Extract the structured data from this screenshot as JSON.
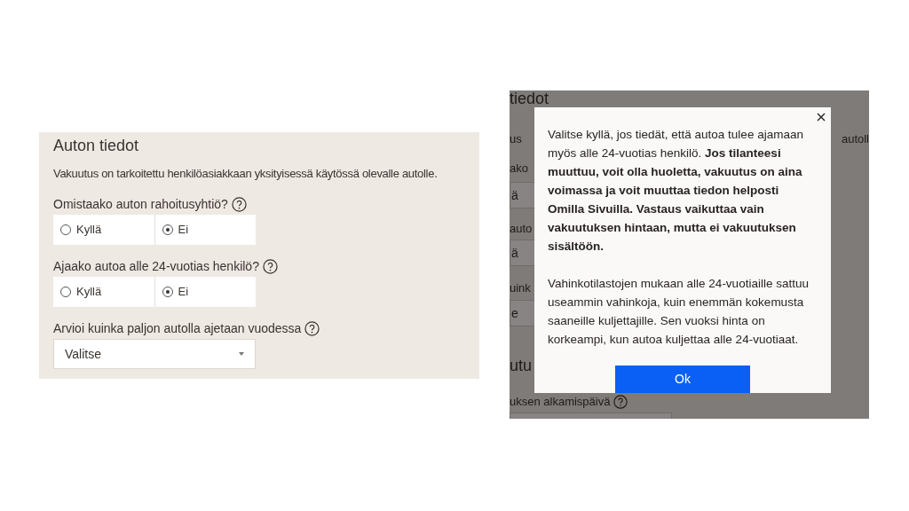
{
  "form": {
    "title": "Auton tiedot",
    "intro": "Vakuutus on tarkoitettu henkilöasiakkaan yksityisessä käytössä olevalle autolle.",
    "questions": [
      {
        "kind": "radio",
        "label": "Omistaako auton rahoitusyhtiö?",
        "options": [
          {
            "label": "Kyllä",
            "selected": false
          },
          {
            "label": "Ei",
            "selected": true
          }
        ]
      },
      {
        "kind": "radio",
        "label": "Ajaako autoa alle 24-vuotias henkilö?",
        "options": [
          {
            "label": "Kyllä",
            "selected": false
          },
          {
            "label": "Ei",
            "selected": true
          }
        ]
      },
      {
        "kind": "select",
        "label": "Arvioi kuinka paljon autolla ajetaan vuodessa",
        "value": "Valitse"
      }
    ]
  },
  "background_page": {
    "rows": [
      {
        "kind": "heading",
        "text": "tiedot"
      },
      {
        "kind": "text",
        "text": "us",
        "right_text": "autoll"
      },
      {
        "kind": "text",
        "text": "ako"
      },
      {
        "kind": "field",
        "text": "ä"
      },
      {
        "kind": "text",
        "text": "auto"
      },
      {
        "kind": "field",
        "text": "ä"
      },
      {
        "kind": "text",
        "text": "uink"
      },
      {
        "kind": "field",
        "text": "e"
      },
      {
        "kind": "heading",
        "text": "utu"
      },
      {
        "kind": "text",
        "text": "uksen alkamispäivä",
        "help": true
      },
      {
        "kind": "date_field"
      }
    ]
  },
  "dialog": {
    "paragraphs": [
      "Valitse kyllä, jos tiedät, että autoa tulee ajamaan myös alle 24-vuotias henkilö. **Jos tilanteesi muuttuu, voit olla huoletta, vakuutus on aina voimassa ja voit muuttaa tiedon helposti Omilla Sivuilla. Vastaus vaikuttaa vain vakuutuksen hintaan, mutta ei vakuutuksen sisältöön.**",
      "Vahinkotilastojen mukaan alle 24-vuotiaille sattuu useammin vahinkoja, kuin enemmän kokemusta saaneille kuljettajille. Sen vuoksi hinta on korkeampi, kun autoa kuljettaa alle 24-vuotiaat."
    ],
    "button": "Ok"
  }
}
